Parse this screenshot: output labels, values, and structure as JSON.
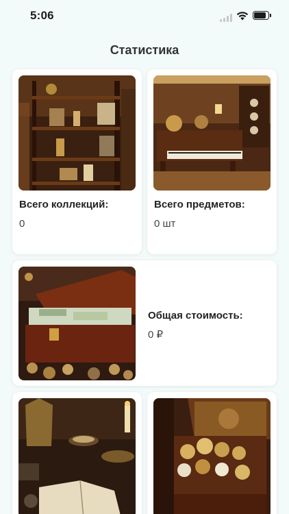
{
  "status_bar": {
    "time": "5:06"
  },
  "header": {
    "title": "Статистика"
  },
  "stats": {
    "collections": {
      "label": "Всего коллекций:",
      "value": "0"
    },
    "items": {
      "label": "Всего предметов:",
      "value": "0 шт"
    },
    "total_value": {
      "label": "Общая стоимость:",
      "value": "0 ₽"
    }
  }
}
